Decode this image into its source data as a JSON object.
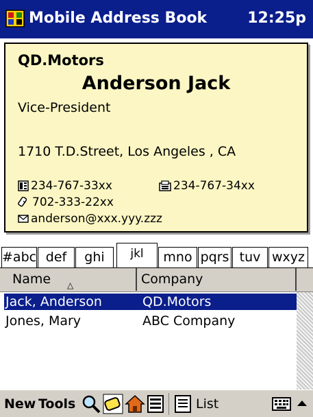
{
  "titlebar": {
    "title": "Mobile Address Book",
    "time": "12:25p",
    "icon": "address-book-app-icon"
  },
  "card": {
    "company": "QD.Motors",
    "name": "Anderson Jack",
    "role": "Vice-President",
    "address": "1710 T.D.Street, Los Angeles , CA",
    "work_phone": "234-767-33xx",
    "fax": "234-767-34xx",
    "mobile": "702-333-22xx",
    "email": "anderson@xxx.yyy.zzz"
  },
  "tabs": [
    {
      "label": "#abc",
      "active": false
    },
    {
      "label": "def",
      "active": false
    },
    {
      "label": "ghi",
      "active": false
    },
    {
      "label": "jkl",
      "active": true
    },
    {
      "label": "mno",
      "active": false
    },
    {
      "label": "pqrs",
      "active": false
    },
    {
      "label": "tuv",
      "active": false
    },
    {
      "label": "wxyz",
      "active": false
    }
  ],
  "list": {
    "columns": [
      "Name",
      "Company"
    ],
    "sort_indicator": "△",
    "rows": [
      {
        "name": "Jack, Anderson",
        "company": "QD.Motors",
        "selected": true
      },
      {
        "name": "Jones, Mary",
        "company": "ABC Company",
        "selected": false
      }
    ]
  },
  "toolbar": {
    "new_label": "New",
    "tools_label": "Tools",
    "list_label": "List",
    "icons": [
      "find-icon",
      "card-view-icon",
      "home-icon",
      "detail-view-icon",
      "list-view-icon",
      "keyboard-icon",
      "input-arrow-icon"
    ]
  },
  "colors": {
    "title_bar": "#0a1e8c",
    "card_bg": "#fbf6c3",
    "selection": "#0a1e8c",
    "toolbar_bg": "#d4d0c8"
  }
}
